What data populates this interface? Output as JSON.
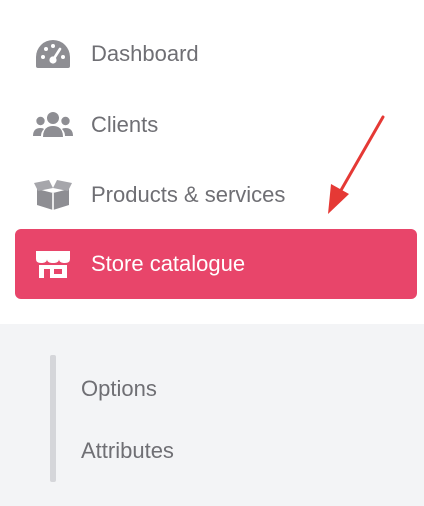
{
  "menu": {
    "items": [
      {
        "label": "Dashboard",
        "icon": "gauge-icon"
      },
      {
        "label": "Clients",
        "icon": "users-icon"
      },
      {
        "label": "Products & services",
        "icon": "box-icon"
      },
      {
        "label": "Store catalogue",
        "icon": "store-icon",
        "active": true
      }
    ]
  },
  "submenu": {
    "items": [
      {
        "label": "Options"
      },
      {
        "label": "Attributes"
      }
    ]
  },
  "colors": {
    "accent": "#e8456a",
    "text": "#6f6f74",
    "icon": "#8e8e93",
    "submenu_bg": "#f3f4f6",
    "annotation_arrow": "#e53935"
  }
}
